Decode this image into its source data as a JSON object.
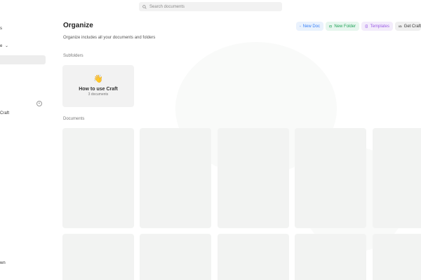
{
  "search": {
    "placeholder": "Search documents"
  },
  "sidebar": {
    "item_top": "s",
    "item_dropdown": "e",
    "item_craft": "Craft",
    "item_bottom": "wn"
  },
  "header": {
    "title": "Organize",
    "subtitle": "Organize includes all your documents and folders"
  },
  "toolbar": {
    "new_doc_label": "New Doc",
    "new_folder_label": "New Folder",
    "templates_label": "Templates",
    "get_craft_label": "Get Craft"
  },
  "colors": {
    "new_doc": "#3b82f6",
    "new_folder": "#22a35a",
    "templates": "#9b5de5",
    "get_craft": "#333333"
  },
  "sections": {
    "subfolders": "Subfolders",
    "documents": "Documents"
  },
  "folder": {
    "emoji": "👋",
    "name": "How to use Craft",
    "count": "3 documents"
  }
}
